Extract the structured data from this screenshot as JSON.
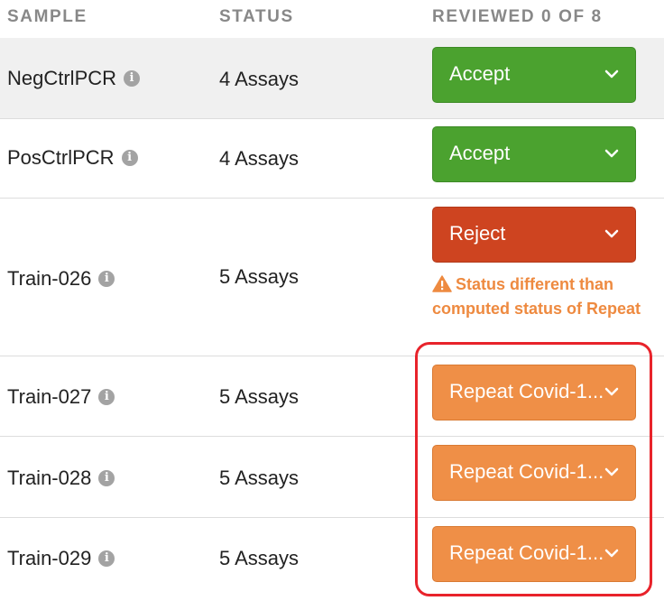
{
  "header": {
    "sample": "SAMPLE",
    "status": "STATUS",
    "reviewed": "REVIEWED 0 OF 8"
  },
  "rows": [
    {
      "sample": "NegCtrlPCR",
      "status": "4 Assays",
      "decision": "Accept",
      "decision_color": "#4ba22f"
    },
    {
      "sample": "PosCtrlPCR",
      "status": "4 Assays",
      "decision": "Accept",
      "decision_color": "#4ba22f"
    },
    {
      "sample": "Train-026",
      "status": "5 Assays",
      "decision": "Reject",
      "decision_color": "#ce4420",
      "warning": "Status different than computed status of Repeat"
    },
    {
      "sample": "Train-027",
      "status": "5 Assays",
      "decision": "Repeat Covid-1...",
      "decision_color": "#ef8f47"
    },
    {
      "sample": "Train-028",
      "status": "5 Assays",
      "decision": "Repeat Covid-1...",
      "decision_color": "#ef8f47"
    },
    {
      "sample": "Train-029",
      "status": "5 Assays",
      "decision": "Repeat Covid-1...",
      "decision_color": "#ef8f47"
    }
  ],
  "icons": {
    "info": "info-icon",
    "dropdown": "chevron-down-icon",
    "warning": "warning-triangle-icon"
  },
  "info_glyph": "i",
  "colors": {
    "header_text": "#888888",
    "warning_text": "#ee8a40",
    "highlight_border": "#e8232b"
  }
}
